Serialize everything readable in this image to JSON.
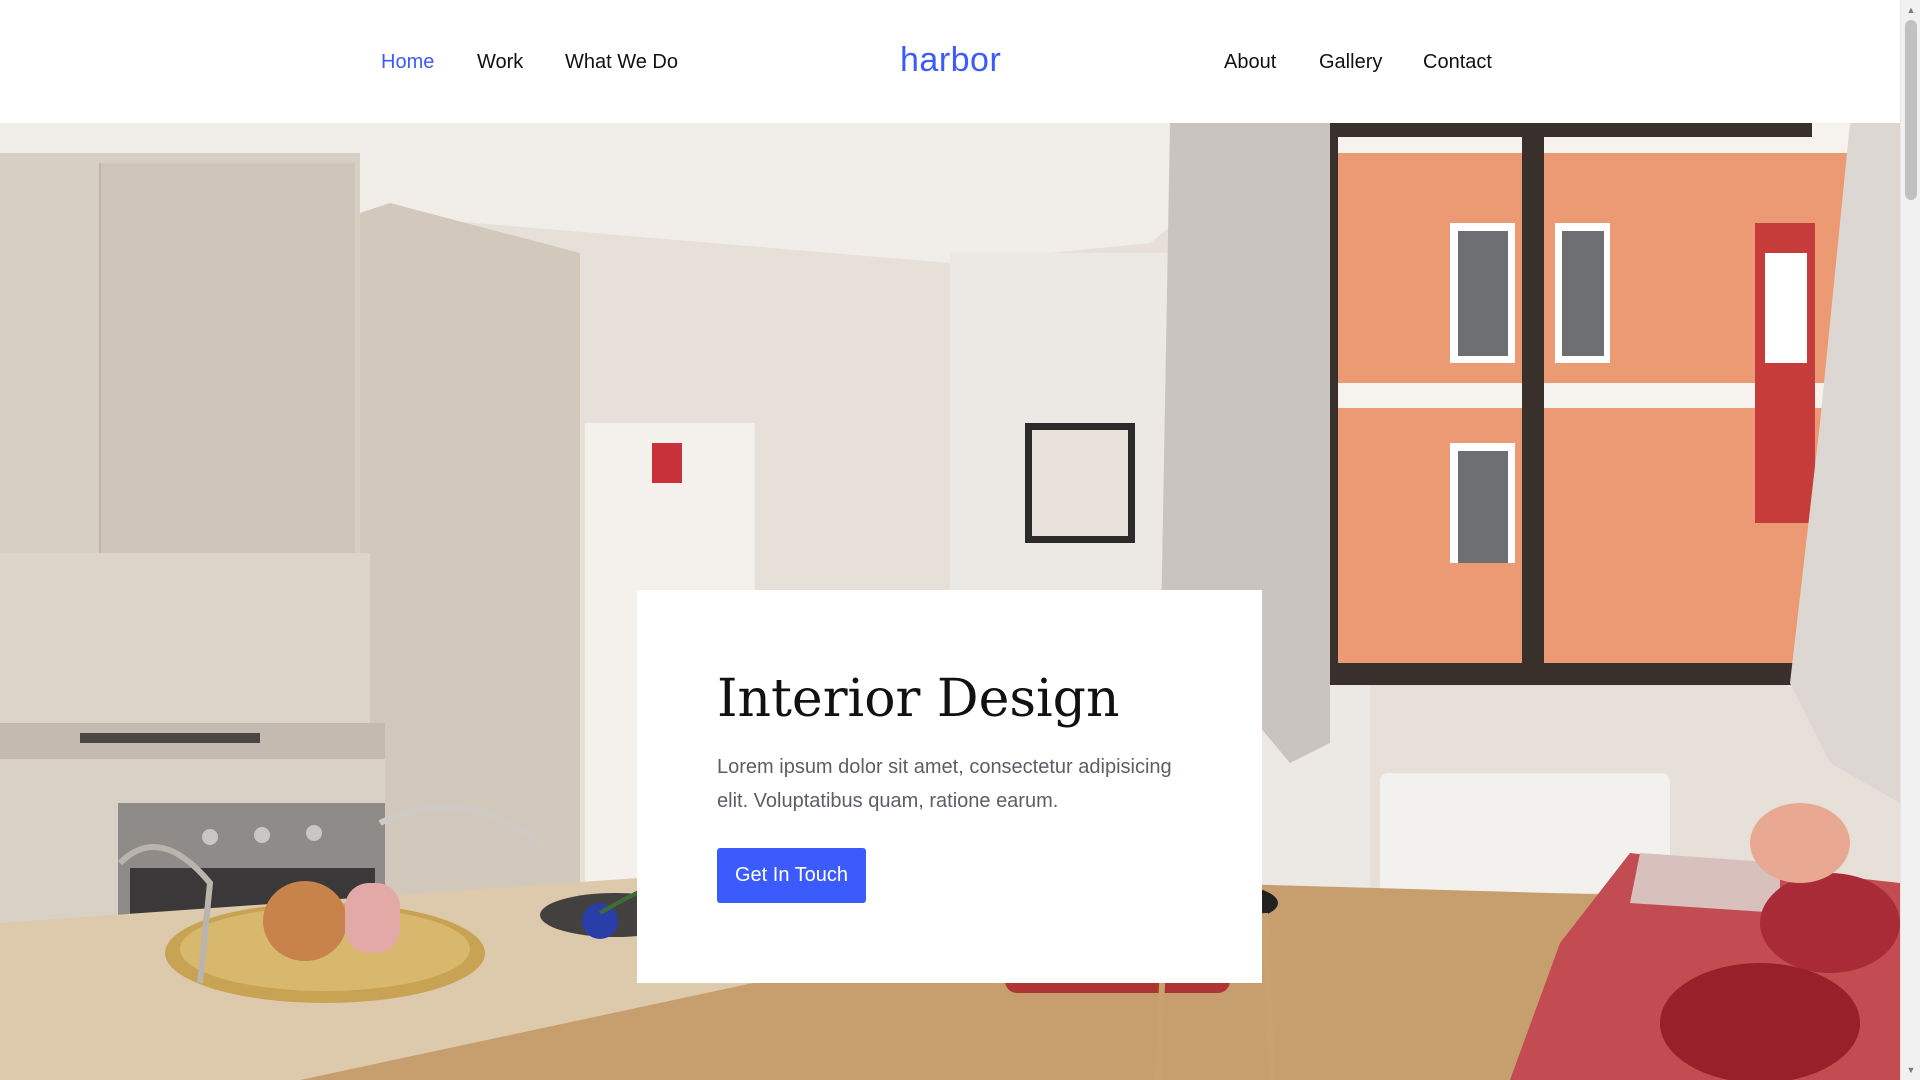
{
  "header": {
    "logo": "harbor",
    "nav_left": [
      {
        "label": "Home",
        "active": true
      },
      {
        "label": "Work",
        "active": false
      },
      {
        "label": "What We Do",
        "active": false
      }
    ],
    "nav_right": [
      {
        "label": "About",
        "active": false
      },
      {
        "label": "Gallery",
        "active": false
      },
      {
        "label": "Contact",
        "active": false
      }
    ]
  },
  "hero": {
    "title": "Interior Design",
    "text": "Lorem ipsum dolor sit amet, consectetur adipisicing elit. Voluptatibus quam, ratione earum.",
    "cta_label": "Get In Touch"
  },
  "colors": {
    "accent": "#3b5bfd",
    "text": "#111111",
    "muted": "#5a5f66"
  },
  "icons": {
    "scroll_up": "triangle-up-icon",
    "scroll_down": "triangle-down-icon"
  }
}
